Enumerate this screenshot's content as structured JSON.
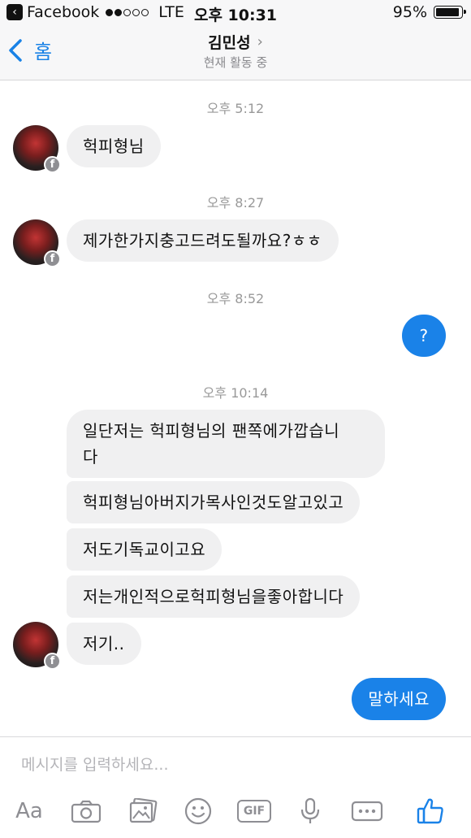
{
  "status_bar": {
    "back_app": "Facebook",
    "carrier": "LTE",
    "time": "오후 10:31",
    "battery_text": "95%",
    "battery_level": 0.95,
    "signal_filled": 2,
    "signal_total": 5
  },
  "nav": {
    "back_label": "홈",
    "title": "김민성",
    "subtitle": "현재 활동 중"
  },
  "messages": {
    "ts1": "오후 5:12",
    "m1": "헉피형님",
    "ts2": "오후 8:27",
    "m2": "제가한가지충고드려도될까요?ㅎㅎ",
    "ts3": "오후 8:52",
    "m3": "?",
    "ts4": "오후 10:14",
    "m4_line1": "일단저는 헉피형님의 팬쪽에가깝습니",
    "m4_line2": "다",
    "m5": "헉피형님아버지가목사인것도알고있고",
    "m6": "저도기독교이고요",
    "m7": "저는개인적으로헉피형님을좋아합니다",
    "m8": "저기..",
    "m9": "말하세요"
  },
  "avatar_badge": "f",
  "composer": {
    "placeholder": "메시지를 입력하세요...",
    "aa_label": "Aa",
    "gif_label": "GIF"
  },
  "icons": {
    "back": "chevron-left-icon",
    "camera": "camera-icon",
    "gallery": "gallery-icon",
    "emoji": "emoji-icon",
    "gif": "gif-icon",
    "mic": "microphone-icon",
    "more": "more-icon",
    "like": "thumbs-up-icon"
  },
  "colors": {
    "accent": "#1a82e8",
    "incoming_bubble": "#f0f0f1",
    "muted": "#8e8e93"
  }
}
